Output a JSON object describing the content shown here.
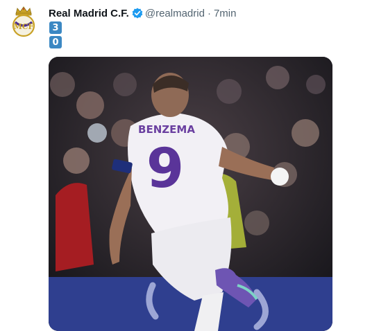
{
  "tweet": {
    "author_name": "Real Madrid C.F.",
    "handle": "@realmadrid",
    "separator": "·",
    "time": "7min",
    "score_keycaps": [
      "3",
      "0"
    ],
    "media": {
      "jersey_name": "BENZEMA",
      "jersey_number": "9"
    }
  },
  "colors": {
    "keycap": "#3b88c3",
    "verified": "#1d9bf0",
    "secondary_text": "#536471",
    "board_blue": "#2f3f8f"
  },
  "icons": {
    "avatar": "real-madrid-crest-icon",
    "verified": "verified-badge-icon"
  }
}
